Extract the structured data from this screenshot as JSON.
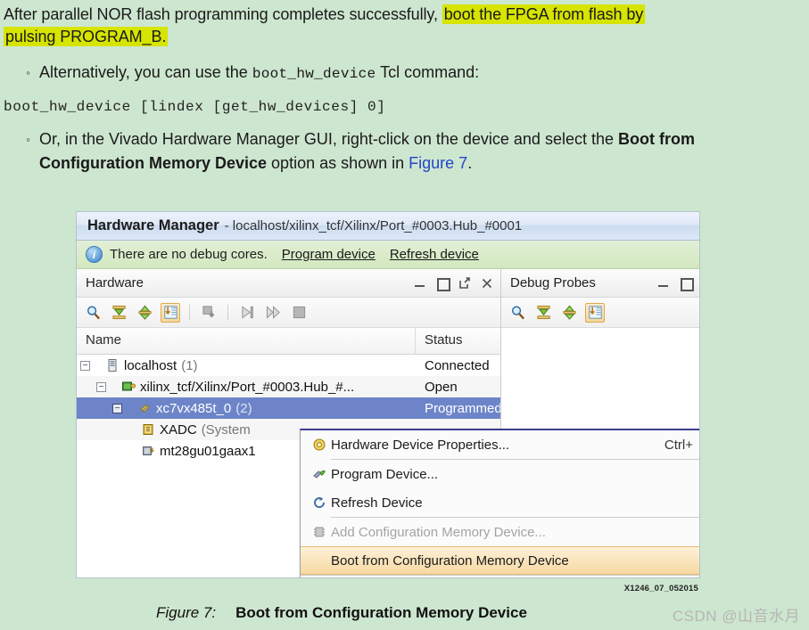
{
  "document": {
    "para1_before": "After parallel NOR flash programming completes successfully, ",
    "para1_highlight_a": "boot the FPGA from flash by",
    "para1_highlight_b": "pulsing PROGRAM_B.",
    "bullet_marker": "◦",
    "bullet1_before": "Alternatively, you can use the ",
    "bullet1_mono": "boot_hw_device",
    "bullet1_after": " Tcl command:",
    "code_line": "boot_hw_device   [lindex [get_hw_devices] 0]",
    "bullet2_before": "Or, in the Vivado Hardware Manager GUI, right-click on the device and select the ",
    "bullet2_bold": "Boot from Configuration Memory Device",
    "bullet2_mid": " option as shown in ",
    "bullet2_link": "Figure 7",
    "bullet2_end": "."
  },
  "hardware_manager": {
    "title": "Hardware Manager",
    "title_sub": "- localhost/xilinx_tcf/Xilinx/Port_#0003.Hub_#0001",
    "info_text": "There are no debug cores.",
    "info_link_1": "Program device",
    "info_link_2": "Refresh device",
    "info_icon": "info-icon"
  },
  "hardware_panel": {
    "title": "Hardware",
    "window_buttons": [
      "minimize-button",
      "maximize-button",
      "float-button",
      "close-button"
    ],
    "toolbar_icons": [
      "search-icon",
      "collapse-all-icon",
      "expand-all-icon",
      "auto-scroll-icon",
      "export-icon",
      "run-icon",
      "step-icon",
      "stop-icon"
    ],
    "columns": [
      "Name",
      "Status"
    ],
    "rows": [
      {
        "name": "localhost",
        "count": "(1)",
        "status": "Connected",
        "indent": 0,
        "twisty": "−",
        "icon": "host-icon",
        "selected": false
      },
      {
        "name": "xilinx_tcf/Xilinx/Port_#0003.Hub_#...",
        "count": "",
        "status": "Open",
        "indent": 1,
        "twisty": "−",
        "icon": "target-icon",
        "selected": false
      },
      {
        "name": "xc7vx485t_0",
        "count": "(2)",
        "status": "Programmed",
        "indent": 2,
        "twisty": "−",
        "icon": "device-icon",
        "selected": true
      },
      {
        "name": "XADC",
        "count": "(System",
        "status": "",
        "indent": 3,
        "twisty": "",
        "icon": "xadc-icon",
        "selected": false
      },
      {
        "name": "mt28gu01gaax1",
        "count": "",
        "status": "",
        "indent": 3,
        "twisty": "",
        "icon": "flash-icon",
        "selected": false
      }
    ]
  },
  "debug_probes_panel": {
    "title": "Debug Probes",
    "window_buttons": [
      "minimize-button",
      "maximize-button"
    ],
    "toolbar_icons": [
      "search-icon",
      "collapse-all-icon",
      "expand-all-icon",
      "auto-scroll-icon"
    ]
  },
  "context_menu": {
    "items": [
      {
        "label": "Hardware Device Properties...",
        "accel": "Ctrl+",
        "icon": "properties-icon",
        "disabled": false,
        "highlighted": false,
        "separator_after": true
      },
      {
        "label": "Program Device...",
        "accel": "",
        "icon": "program-device-icon",
        "disabled": false,
        "highlighted": false,
        "separator_after": false
      },
      {
        "label": "Refresh Device",
        "accel": "",
        "icon": "refresh-device-icon",
        "disabled": false,
        "highlighted": false,
        "separator_after": true
      },
      {
        "label": "Add Configuration Memory Device...",
        "accel": "",
        "icon": "add-config-memory-icon",
        "disabled": true,
        "highlighted": false,
        "separator_after": false
      },
      {
        "label": "Boot from Configuration Memory Device",
        "accel": "",
        "icon": "",
        "disabled": false,
        "highlighted": true,
        "separator_after": false
      }
    ]
  },
  "figure": {
    "id_label": "X1246_07_052015",
    "number": "Figure 7:",
    "caption": "Boot from Configuration Memory Device"
  },
  "watermark": {
    "text": "CSDN @山音水月"
  },
  "colors": {
    "page_background": "#cde6cf",
    "highlight": "#d6e400",
    "link": "#2346c8",
    "selection": "#6d85c8",
    "menu_highlight": "#f7d9a2"
  }
}
